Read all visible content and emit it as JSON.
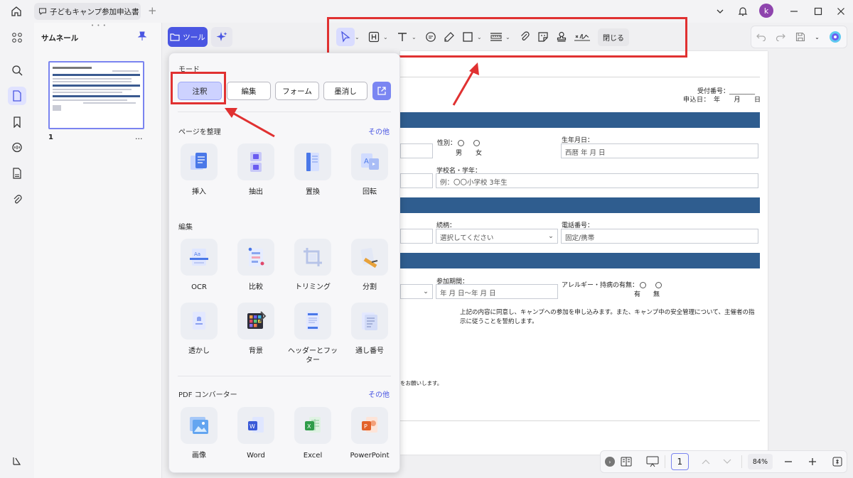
{
  "tab": {
    "title": "子どもキャンプ参加申込書",
    "new_tab": "+"
  },
  "user": {
    "avatar": "k"
  },
  "thumbnails": {
    "title": "サムネール",
    "drag_dots": "• • •",
    "page_number": "1",
    "more": "..."
  },
  "tools": {
    "tool_label": "ツール"
  },
  "toolbar": {
    "close_label": "閉じる"
  },
  "panel": {
    "mode_title": "モード",
    "modes": [
      "注釈",
      "編集",
      "フォーム",
      "墨消し"
    ],
    "organize_title": "ページを整理",
    "organize_more": "その他",
    "organize_tools": [
      "挿入",
      "抽出",
      "置換",
      "回転"
    ],
    "edit_title": "編集",
    "edit_tools": [
      "OCR",
      "比較",
      "トリミング",
      "分割",
      "透かし",
      "背景",
      "ヘッダーとフッター",
      "通し番号"
    ],
    "converter_title": "PDF コンバーター",
    "converter_more": "その他",
    "converter_tools": [
      "画像",
      "Word",
      "Excel",
      "PowerPoint"
    ]
  },
  "document": {
    "receipt_no_label": "受付番号：",
    "apply_date_label": "申込日：　年　　月　　日",
    "gender_label": "性別：",
    "gender_male": "男",
    "gender_female": "女",
    "birth_label": "生年月日：",
    "birth_placeholder": "西暦 年 月 日",
    "school_label": "学校名・学年：",
    "school_placeholder": "例：〇〇小学校 3年生",
    "relation_label": "続柄：",
    "relation_value": "選択してください",
    "phone_label": "電話番号：",
    "phone_placeholder": "固定/携帯",
    "period_label": "参加期間：",
    "period_placeholder": "年 月 日～年 月 日",
    "allergy_label": "アレルギー・持病の有無：",
    "allergy_yes": "有",
    "allergy_no": "無",
    "agreement_text": "上記の内容に同意し、キャンプへの参加を申し込みます。また、キャンプ中の安全管理について、主催者の指示に従うことを誓約します。",
    "footer_fragment": "をお願いします。"
  },
  "bottom": {
    "page": "1",
    "zoom": "84%"
  },
  "colors": {
    "accent": "#4a56e2",
    "highlight": "#e03131",
    "doc_header": "#2f5d8f"
  }
}
